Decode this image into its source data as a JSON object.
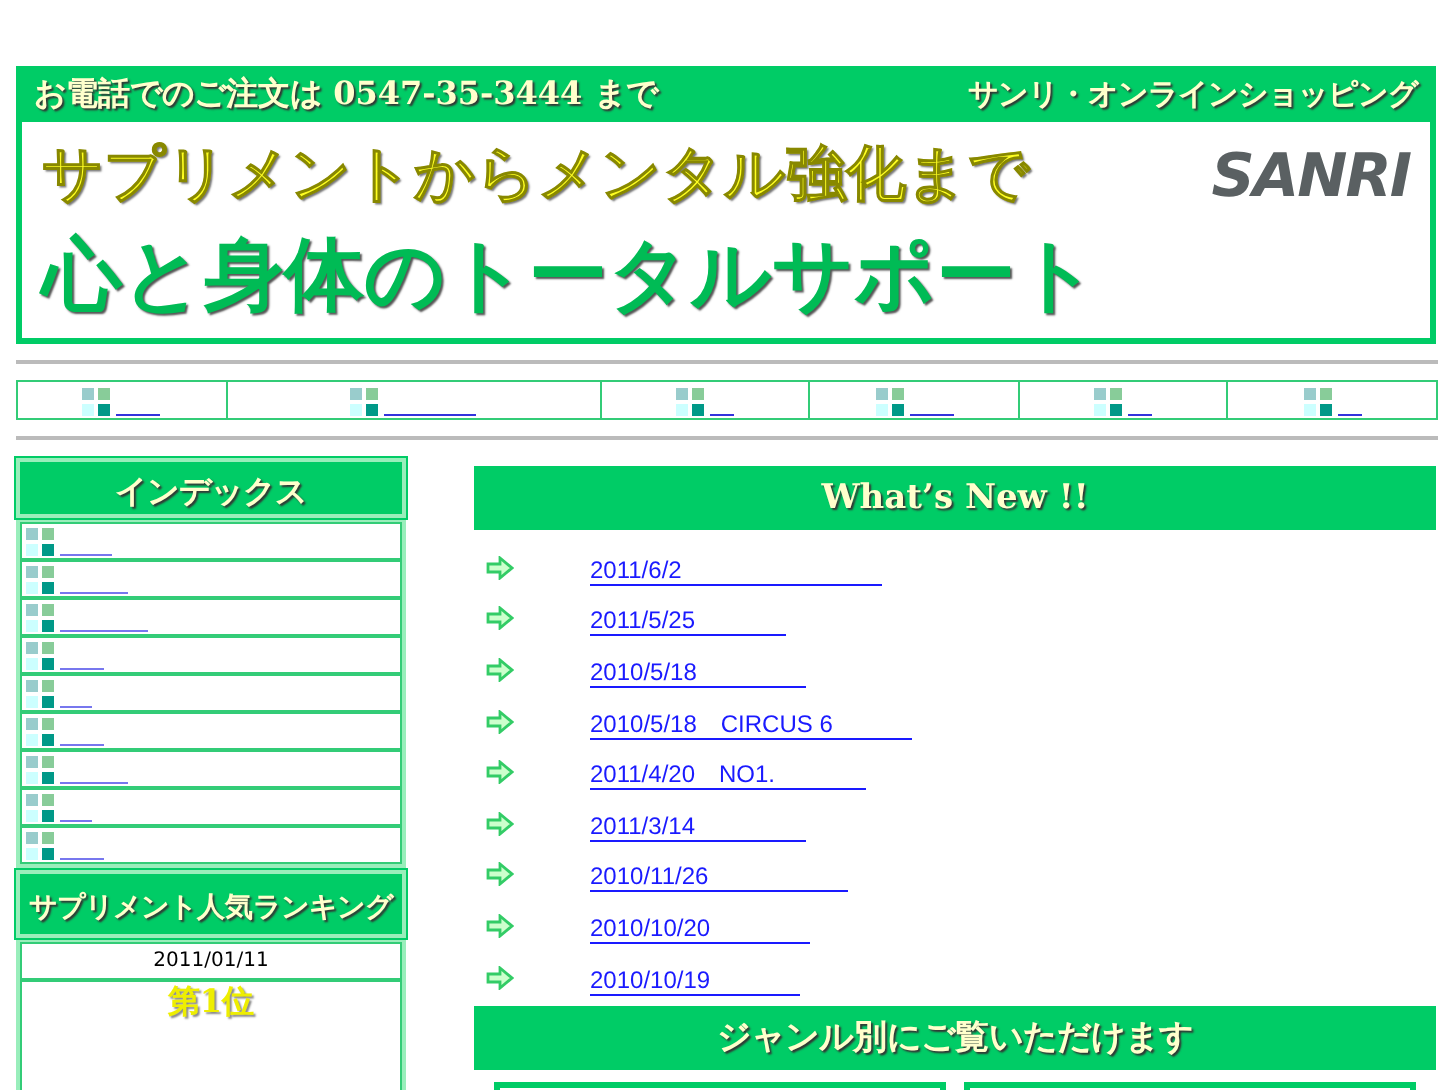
{
  "header": {
    "phone": "お電話でのご注文は 0547-35-3444 まで",
    "shop": "サンリ・オンラインショッピング",
    "tagline": "サプリメントからメンタル強化まで",
    "headline": "心と身体のトータルサポート",
    "logo": "SANRI"
  },
  "nav": [
    {
      "kind": "link"
    },
    {
      "kind": "link"
    },
    {
      "kind": "link"
    },
    {
      "kind": "link"
    },
    {
      "kind": "link"
    },
    {
      "kind": "link"
    }
  ],
  "sidebar": {
    "index_title": "インデックス",
    "index_items": [
      {
        "kind": "link"
      },
      {
        "kind": "link"
      },
      {
        "kind": "link"
      },
      {
        "kind": "link"
      },
      {
        "kind": "link"
      },
      {
        "kind": "link"
      },
      {
        "kind": "link"
      },
      {
        "kind": "link"
      },
      {
        "kind": "link"
      }
    ],
    "ranking_title": "サプリメント人気ランキング",
    "ranking_date": "2011/01/11",
    "rank": "第1位"
  },
  "whats_new": {
    "title": "What’s  New !!",
    "items": [
      {
        "text": "2011/6/2"
      },
      {
        "text": "2011/5/25"
      },
      {
        "text": "2010/5/18"
      },
      {
        "text": "2010/5/18　CIRCUS 6"
      },
      {
        "text": "2011/4/20　NO1."
      },
      {
        "text": "2011/3/14"
      },
      {
        "text": "2010/11/26"
      },
      {
        "text": "2010/10/20"
      },
      {
        "text": "2010/10/19"
      }
    ]
  },
  "genre": {
    "title": "ジャンル別にご覧いただけます",
    "boxes": [
      {
        "kind": "box"
      },
      {
        "kind": "box"
      }
    ]
  }
}
